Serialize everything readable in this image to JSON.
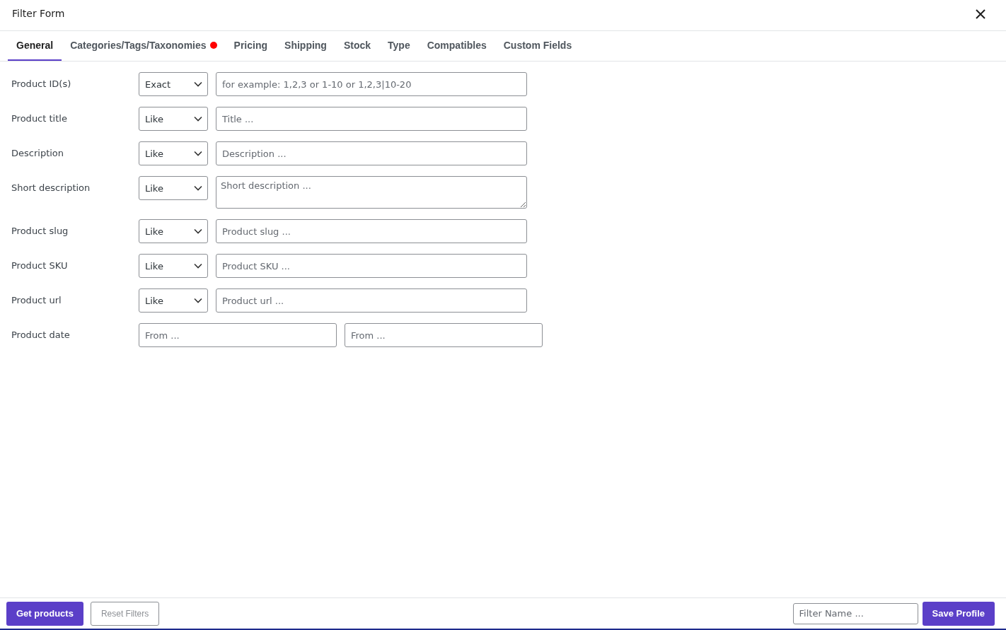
{
  "window": {
    "title": "Filter Form"
  },
  "tabs": [
    {
      "label": "General",
      "selected": true,
      "marked": false
    },
    {
      "label": "Categories/Tags/Taxonomies",
      "selected": false,
      "marked": true
    },
    {
      "label": "Pricing",
      "selected": false,
      "marked": false
    },
    {
      "label": "Shipping",
      "selected": false,
      "marked": false
    },
    {
      "label": "Stock",
      "selected": false,
      "marked": false
    },
    {
      "label": "Type",
      "selected": false,
      "marked": false
    },
    {
      "label": "Compatibles",
      "selected": false,
      "marked": false
    },
    {
      "label": "Custom Fields",
      "selected": false,
      "marked": false
    }
  ],
  "fields": [
    {
      "kind": "text",
      "label": "Product ID(s)",
      "operator": "Exact",
      "placeholder": "for example: 1,2,3 or 1-10 or 1,2,3|10-20"
    },
    {
      "kind": "text",
      "label": "Product title",
      "operator": "Like",
      "placeholder": "Title ..."
    },
    {
      "kind": "text",
      "label": "Description",
      "operator": "Like",
      "placeholder": "Description ..."
    },
    {
      "kind": "textarea",
      "label": "Short description",
      "operator": "Like",
      "placeholder": "Short description ..."
    },
    {
      "kind": "text",
      "label": "Product slug",
      "operator": "Like",
      "placeholder": "Product slug ..."
    },
    {
      "kind": "text",
      "label": "Product SKU",
      "operator": "Like",
      "placeholder": "Product SKU ..."
    },
    {
      "kind": "text",
      "label": "Product url",
      "operator": "Like",
      "placeholder": "Product url ..."
    },
    {
      "kind": "range",
      "label": "Product date",
      "from_placeholder": "From ...",
      "to_placeholder": "From ..."
    }
  ],
  "footer": {
    "get_button": "Get products",
    "reset_button": "Reset Filters",
    "name_placeholder": "Filter Name ...",
    "save_button": "Save Profile"
  }
}
